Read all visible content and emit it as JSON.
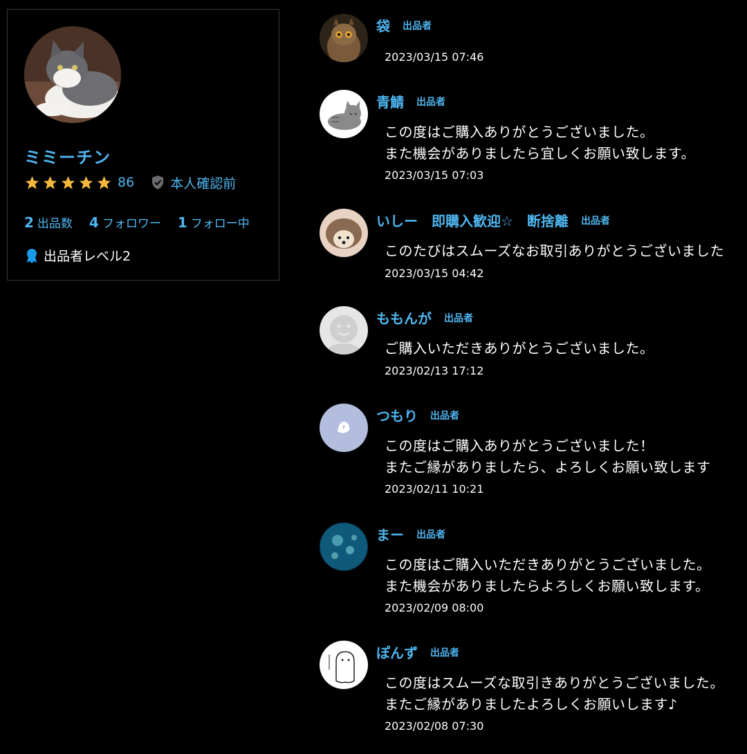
{
  "profile": {
    "name": "ミミーチン",
    "rating_count": "86",
    "star_count": 5,
    "verification": "本人確認前",
    "stats": [
      {
        "num": "2",
        "label": "出品数"
      },
      {
        "num": "4",
        "label": "フォロワー"
      },
      {
        "num": "1",
        "label": "フォロー中"
      }
    ],
    "level": "出品者レベル2",
    "avatar_icon": "cat-photo-avatar"
  },
  "colors": {
    "accent": "#4fb6f0",
    "star": "#f5b83d",
    "background": "#000000"
  },
  "reviews": [
    {
      "name": "袋",
      "role": "出品者",
      "lines": [],
      "date": "2023/03/15 07:46",
      "avatar": "owl-photo-avatar"
    },
    {
      "name": "青鯖",
      "role": "出品者",
      "lines": [
        "この度はご購入ありがとうございました。",
        "また機会がありましたら宜しくお願い致します。"
      ],
      "date": "2023/03/15 07:03",
      "avatar": "gray-cat-illustration-avatar"
    },
    {
      "name": "いしー　即購入歓迎☆　断捨離",
      "role": "出品者",
      "lines": [
        "このたびはスムーズなお取引ありがとうございました"
      ],
      "date": "2023/03/15 04:42",
      "avatar": "hedgehog-photo-avatar"
    },
    {
      "name": "ももんが",
      "role": "出品者",
      "lines": [
        "ご購入いただきありがとうございました。"
      ],
      "date": "2023/02/13 17:12",
      "avatar": "default-user-avatar"
    },
    {
      "name": "つもり",
      "role": "出品者",
      "lines": [
        "この度はご購入ありがとうございました！",
        "またご縁がありましたら、よろしくお願い致します"
      ],
      "date": "2023/02/11 10:21",
      "avatar": "rice-ball-illustration-avatar"
    },
    {
      "name": "まー",
      "role": "出品者",
      "lines": [
        "この度はご購入いただきありがとうございました。",
        "また機会がありましたらよろしくお願い致します。"
      ],
      "date": "2023/02/09 08:00",
      "avatar": "jellyfish-photo-avatar"
    },
    {
      "name": "ぽんず",
      "role": "出品者",
      "lines": [
        "この度はスムーズな取引きありがとうございました。",
        "またご縁がありましたよろしくお願いします♪"
      ],
      "date": "2023/02/08 07:30",
      "avatar": "ghost-sketch-avatar"
    }
  ]
}
